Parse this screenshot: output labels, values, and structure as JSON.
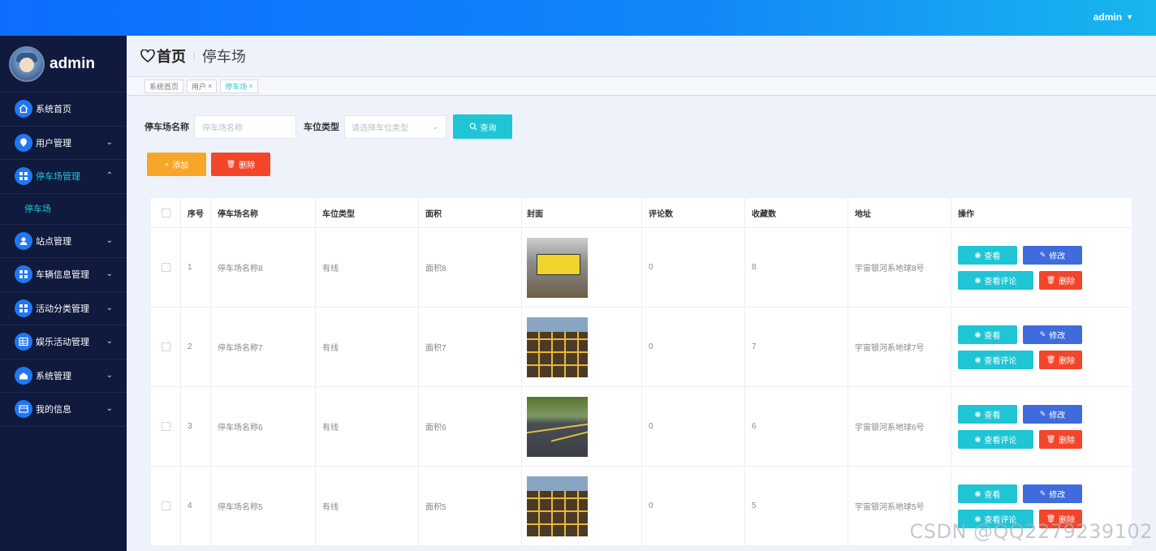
{
  "header": {
    "user_label": "admin"
  },
  "sidebar": {
    "username": "admin",
    "items": [
      {
        "label": "系统首页",
        "icon": "home-icon"
      },
      {
        "label": "用户管理",
        "icon": "location-pin-icon"
      },
      {
        "label": "停车场管理",
        "icon": "grid-icon"
      },
      {
        "label": "站点管理",
        "icon": "user-icon"
      },
      {
        "label": "车辆信息管理",
        "icon": "grid-icon"
      },
      {
        "label": "活动分类管理",
        "icon": "grid-icon"
      },
      {
        "label": "娱乐活动管理",
        "icon": "table-icon"
      },
      {
        "label": "系统管理",
        "icon": "house-icon"
      },
      {
        "label": "我的信息",
        "icon": "card-icon"
      }
    ],
    "submenu": {
      "label": "停车场"
    }
  },
  "breadcrumb": {
    "home": "首页",
    "current": "停车场"
  },
  "tabs": [
    {
      "label": "系统首页"
    },
    {
      "label": "用户"
    },
    {
      "label": "停车场"
    }
  ],
  "search": {
    "name_label": "停车场名称",
    "name_placeholder": "停车场名称",
    "type_label": "车位类型",
    "type_placeholder": "请选择车位类型",
    "query_label": "查询"
  },
  "actions": {
    "add_label": "添加",
    "delete_label": "删除"
  },
  "table": {
    "columns": [
      "序号",
      "停车场名称",
      "车位类型",
      "面积",
      "封面",
      "评论数",
      "收藏数",
      "地址",
      "操作"
    ],
    "rows": [
      {
        "index": "1",
        "name": "停车场名称8",
        "type": "有线",
        "area": "面积8",
        "comments": "0",
        "favorites": "8",
        "address": "宇宙银河系地球8号"
      },
      {
        "index": "2",
        "name": "停车场名称7",
        "type": "有线",
        "area": "面积7",
        "comments": "0",
        "favorites": "7",
        "address": "宇宙银河系地球7号"
      },
      {
        "index": "3",
        "name": "停车场名称6",
        "type": "有线",
        "area": "面积6",
        "comments": "0",
        "favorites": "6",
        "address": "宇宙银河系地球6号"
      },
      {
        "index": "4",
        "name": "停车场名称5",
        "type": "有线",
        "area": "面积5",
        "comments": "0",
        "favorites": "5",
        "address": "宇宙银河系地球5号"
      }
    ],
    "ops": {
      "view": "查看",
      "edit": "修改",
      "comments": "查看评论",
      "delete": "删除"
    }
  },
  "watermark": "CSDN @QQ2279239102"
}
